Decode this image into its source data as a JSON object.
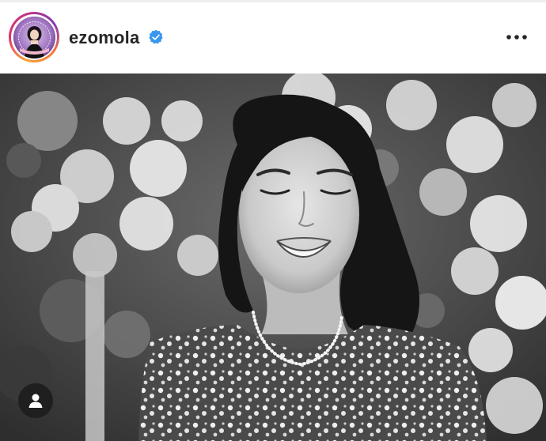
{
  "post": {
    "username": "ezomola",
    "verified": true,
    "avatar_caption": "",
    "photo_style": "black-and-white",
    "photo_subject": "woman-smiling-in-front-of-flowers"
  },
  "icons": {
    "verified": "verified-badge-icon",
    "more": "more-options-icon",
    "user_tag": "user-tag-icon"
  },
  "colors": {
    "username": "#262626",
    "verified_badge": "#3897f0",
    "ring_start": "#f9a23a",
    "ring_end": "#c13584"
  }
}
